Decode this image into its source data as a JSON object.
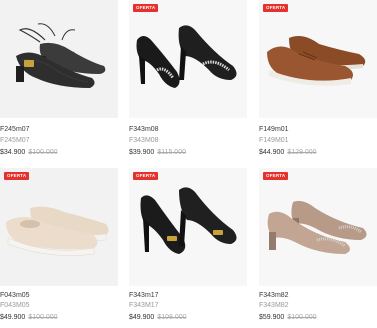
{
  "badge_label": "OFERTA",
  "colors": {
    "badge": "#e5322d",
    "price": "#333333",
    "old_price": "#aaaaaa"
  },
  "products": [
    {
      "title": "F245m07",
      "sku": "F245M07",
      "price": "$34.900",
      "old_price": "$100.000",
      "badge": false,
      "image": "black-strappy-mesh-heel"
    },
    {
      "title": "F343m08",
      "sku": "F343M08",
      "price": "$39.900",
      "old_price": "$115.000",
      "badge": true,
      "image": "black-suede-pump-embellished"
    },
    {
      "title": "F149m01",
      "sku": "F149M01",
      "price": "$44.900",
      "old_price": "$129.000",
      "badge": true,
      "image": "brown-leather-sneaker"
    },
    {
      "title": "F043m05",
      "sku": "F043M05",
      "price": "$49.900",
      "old_price": "$100.000",
      "badge": true,
      "image": "beige-slip-on-sneaker"
    },
    {
      "title": "F343m17",
      "sku": "F343M17",
      "price": "$49.900",
      "old_price": "$108.000",
      "badge": true,
      "image": "black-pump-gold-buckle"
    },
    {
      "title": "F343m82",
      "sku": "F343M82",
      "price": "$59.900",
      "old_price": "$100.000",
      "badge": true,
      "image": "taupe-block-heel-glitter"
    }
  ]
}
